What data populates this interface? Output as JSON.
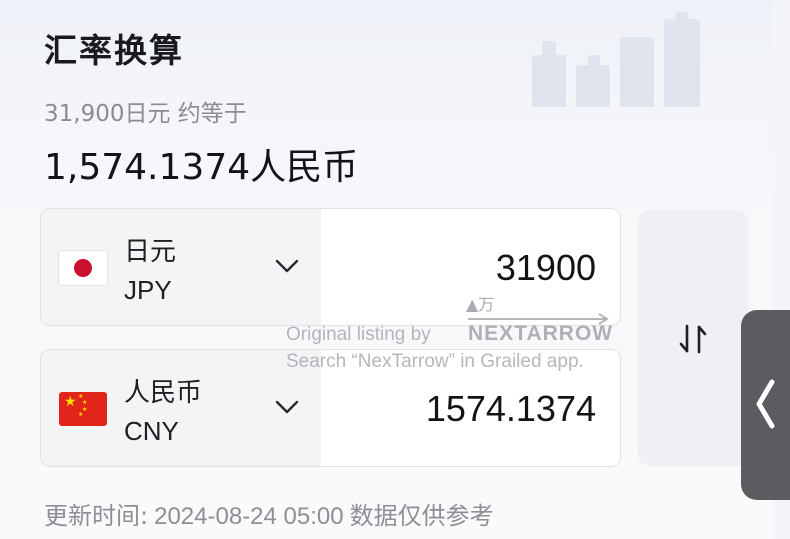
{
  "header": {
    "title": "汇率换算",
    "subtitle": "31,900日元 约等于",
    "result": "1,574.1374人民币"
  },
  "converter": {
    "from": {
      "name": "日元",
      "code": "JPY",
      "amount": "31900",
      "unit_hint": "▲万"
    },
    "to": {
      "name": "人民币",
      "code": "CNY",
      "amount": "1574.1374"
    }
  },
  "watermark": {
    "line1": "Original listing by",
    "brand": "NEXTARROW",
    "line2": "Search “NexTarrow” in Grailed app."
  },
  "footer": {
    "label": "更新时间:",
    "timestamp": "2024-08-24 05:00",
    "note": "数据仅供参考"
  },
  "icons": {
    "swap": "swap-vertical-icon",
    "chevron": "chevron-down-icon",
    "side_tab": "chevron-left-icon"
  },
  "colors": {
    "accent_red": "#c9102f",
    "cn_red": "#e1251b",
    "cn_star": "#ffde00"
  }
}
